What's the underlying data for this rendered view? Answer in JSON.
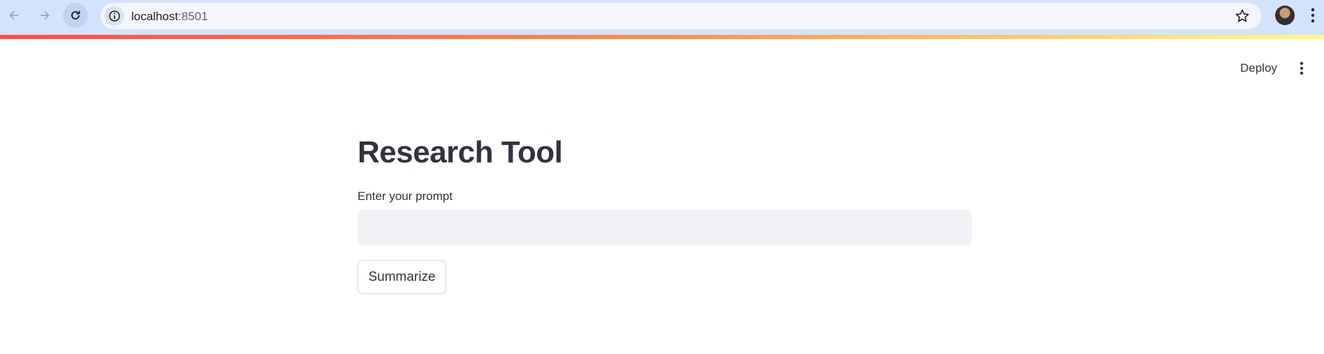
{
  "browser": {
    "url_host": "localhost",
    "url_port": ":8501",
    "icons": {
      "back": "arrow-left-icon",
      "forward": "arrow-right-icon",
      "reload": "reload-icon",
      "site_info": "info-icon",
      "bookmark": "star-icon",
      "menu": "kebab-menu-icon"
    }
  },
  "toolbar": {
    "deploy_label": "Deploy"
  },
  "main": {
    "title": "Research Tool",
    "prompt_label": "Enter your prompt",
    "prompt_value": "",
    "button_label": "Summarize"
  },
  "colors": {
    "chrome_bg": "#d3e3fd",
    "text": "#31333f",
    "input_bg": "#f0f2f6",
    "accent_red": "#ff4b4b",
    "accent_yellow": "#fffd80"
  }
}
